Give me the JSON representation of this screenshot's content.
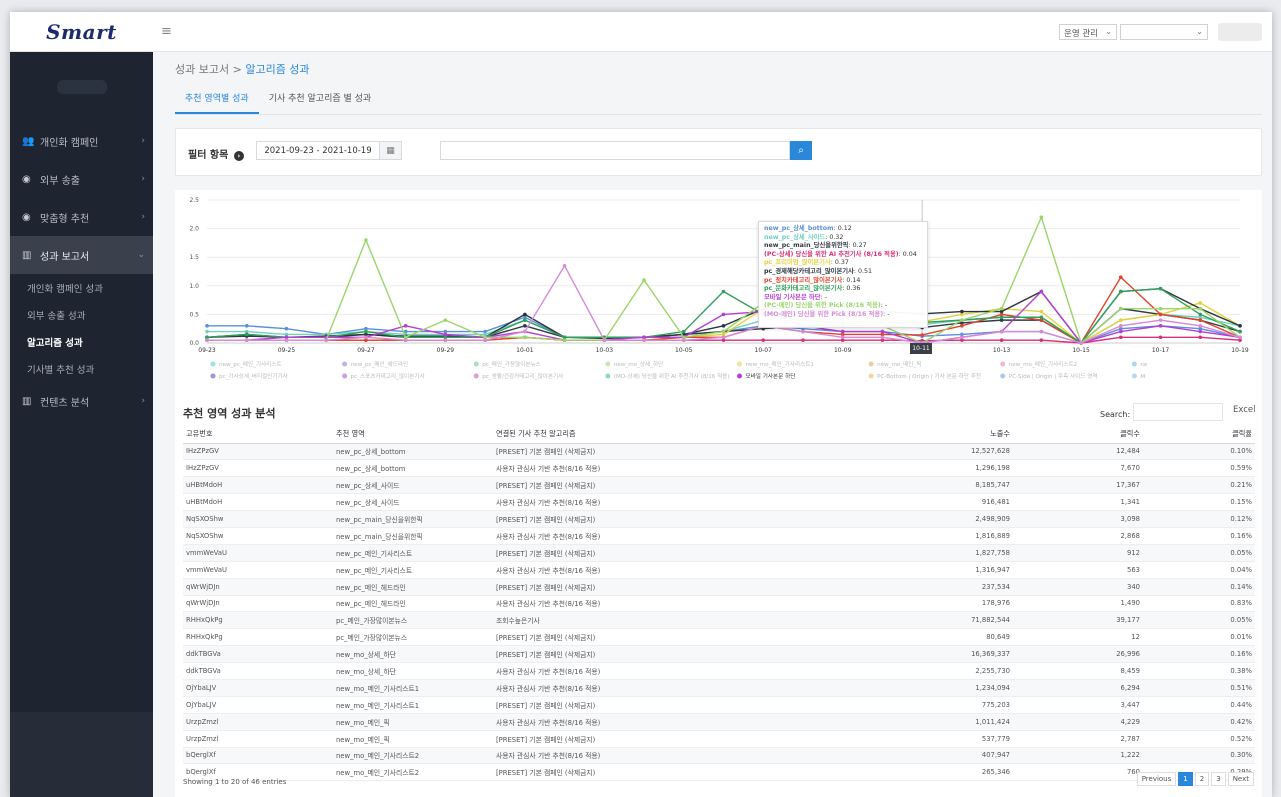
{
  "app": {
    "logo": "Smart"
  },
  "sidebar": {
    "items": [
      {
        "label": "개인화 캠페인",
        "icon": "users-icon"
      },
      {
        "label": "외부 송출",
        "icon": "target-icon"
      },
      {
        "label": "맞춤형 추천",
        "icon": "target-icon"
      },
      {
        "label": "성과 보고서",
        "icon": "bar-chart-icon"
      }
    ],
    "report_sub": [
      "개인화 캠페인 성과",
      "외부 송출 성과",
      "알고리즘 성과",
      "기사별 추천 성과"
    ],
    "bottom_item": {
      "label": "컨텐츠 분석",
      "icon": "bar-chart-icon"
    }
  },
  "topbar": {
    "menu_icon": "≡",
    "admin_select": "운영 관리",
    "site_select": ""
  },
  "breadcrumb": {
    "parent": "성과 보고서",
    "sep": ">",
    "current": "알고리즘 성과"
  },
  "tabs": [
    "추천 영역별 성과",
    "기사 추천 알고리즘 별 성과"
  ],
  "filter": {
    "label": "필터 항목",
    "date_range": "2021-09-23 - 2021-10-19",
    "search_value": ""
  },
  "chart_data": {
    "type": "line",
    "x": [
      "09-23",
      "09-24",
      "09-25",
      "09-26",
      "09-27",
      "09-28",
      "09-29",
      "09-30",
      "10-01",
      "10-02",
      "10-03",
      "10-04",
      "10-05",
      "10-06",
      "10-07",
      "10-08",
      "10-09",
      "10-10",
      "10-11",
      "10-12",
      "10-13",
      "10-14",
      "10-15",
      "10-16",
      "10-17",
      "10-18",
      "10-19"
    ],
    "x_ticks": [
      "09-23",
      "09-25",
      "09-27",
      "09-29",
      "10-01",
      "10-03",
      "10-05",
      "10-07",
      "10-09",
      "10-11",
      "10-13",
      "10-15",
      "10-17",
      "10-19"
    ],
    "y_ticks": [
      "0.0",
      "0.5",
      "1.0",
      "1.5",
      "2.0",
      "2.5"
    ],
    "ylim": [
      0,
      2.5
    ],
    "highlight_x": "10-11",
    "series": [
      {
        "name": "new_pc_상세_bottom",
        "color": "#5b8fd8",
        "values": [
          0.3,
          0.3,
          0.25,
          0.15,
          0.25,
          0.2,
          0.2,
          0.2,
          0.45,
          0.1,
          0.1,
          0.1,
          0.15,
          0.2,
          0.3,
          0.25,
          0.2,
          0.2,
          0.12,
          0.15,
          0.2,
          0.2,
          0.0,
          0.25,
          0.3,
          0.25,
          0.1
        ]
      },
      {
        "name": "new_pc_상세_사이드",
        "color": "#6fd0c0",
        "values": [
          0.2,
          0.2,
          0.15,
          0.15,
          0.2,
          0.15,
          0.15,
          0.15,
          0.4,
          0.1,
          0.1,
          0.1,
          0.1,
          0.2,
          0.4,
          0.4,
          0.35,
          0.35,
          0.32,
          0.4,
          0.45,
          0.45,
          0.0,
          0.4,
          0.5,
          0.45,
          0.3
        ]
      },
      {
        "name": "new_pc_main_당신을위한픽",
        "color": "#333a45",
        "values": [
          0.1,
          0.12,
          0.1,
          0.12,
          0.15,
          0.12,
          0.12,
          0.1,
          0.3,
          0.1,
          0.08,
          0.1,
          0.15,
          0.2,
          0.25,
          0.3,
          0.3,
          0.3,
          0.27,
          0.35,
          0.4,
          0.4,
          0.0,
          0.6,
          0.5,
          0.4,
          0.2
        ]
      },
      {
        "name": "(PC-상세) 당신을 위한 AI 추천기사 (8/16 적용)",
        "color": "#d62f7a",
        "values": [
          0.05,
          0.05,
          0.05,
          0.05,
          0.05,
          0.05,
          0.05,
          0.05,
          0.1,
          0.05,
          0.05,
          0.05,
          0.05,
          0.05,
          0.05,
          0.05,
          0.05,
          0.05,
          0.04,
          0.05,
          0.05,
          0.05,
          0.0,
          0.1,
          0.1,
          0.1,
          0.05
        ]
      },
      {
        "name": "pc_프리미엄_많이본기사",
        "color": "#e3d23a",
        "values": [
          0.05,
          0.05,
          0.05,
          0.05,
          0.1,
          0.05,
          0.05,
          0.05,
          0.1,
          0.05,
          0.05,
          0.05,
          0.1,
          0.15,
          0.6,
          0.5,
          0.4,
          0.4,
          0.37,
          0.5,
          0.6,
          0.55,
          0.0,
          0.4,
          0.5,
          0.7,
          0.3
        ]
      },
      {
        "name": "pc_경제해당카테고리_많이본기사",
        "color": "#2d3440",
        "values": [
          0.1,
          0.15,
          0.1,
          0.1,
          0.15,
          0.1,
          0.1,
          0.1,
          0.5,
          0.1,
          0.1,
          0.1,
          0.15,
          0.3,
          0.6,
          0.6,
          0.55,
          0.55,
          0.51,
          0.55,
          0.55,
          0.9,
          0.0,
          0.9,
          0.95,
          0.6,
          0.3
        ]
      },
      {
        "name": "pc_정치카테고리_많이본기사",
        "color": "#e0442f",
        "values": [
          0.05,
          0.05,
          0.05,
          0.05,
          0.05,
          0.05,
          0.05,
          0.05,
          0.1,
          0.05,
          0.05,
          0.05,
          0.1,
          0.1,
          0.3,
          0.2,
          0.15,
          0.15,
          0.14,
          0.3,
          0.5,
          0.4,
          0.0,
          1.15,
          0.5,
          0.4,
          0.1
        ]
      },
      {
        "name": "pc_문화카테고리_많이본기사",
        "color": "#2fa05a",
        "values": [
          0.1,
          0.15,
          0.1,
          0.1,
          0.2,
          0.1,
          0.1,
          0.1,
          0.4,
          0.1,
          0.1,
          0.1,
          0.2,
          0.9,
          0.5,
          0.4,
          0.35,
          0.35,
          0.36,
          0.4,
          0.45,
          0.45,
          0.0,
          0.9,
          0.95,
          0.5,
          0.2
        ]
      },
      {
        "name": "모바일 기사본문 하단",
        "color": "#b73dd3",
        "values": [
          0.05,
          0.05,
          0.1,
          0.1,
          0.1,
          0.3,
          0.15,
          0.1,
          0.2,
          0.05,
          0.05,
          0.1,
          0.1,
          0.5,
          0.55,
          0.3,
          0.2,
          0.2,
          0.0,
          0.1,
          0.2,
          0.9,
          0.0,
          0.2,
          0.3,
          0.2,
          0.1
        ]
      },
      {
        "name": "(PC-메인) 당신을 위한 Pick (8/16 적용)",
        "color": "#9bd46a",
        "values": [
          0.05,
          0.05,
          0.05,
          0.05,
          1.8,
          0.1,
          0.4,
          0.1,
          0.1,
          0.05,
          0.05,
          1.1,
          0.1,
          0.2,
          0.7,
          0.6,
          0.4,
          0.3,
          0.0,
          0.4,
          0.6,
          2.2,
          0.0,
          0.6,
          0.6,
          0.6,
          0.1
        ]
      },
      {
        "name": "(MO-메인) 당신을 위한 Pick (8/16 적용)",
        "color": "#d78ad9",
        "values": [
          0.05,
          0.05,
          0.05,
          0.05,
          0.1,
          0.05,
          0.05,
          0.05,
          0.2,
          1.35,
          0.05,
          0.05,
          0.05,
          0.1,
          0.3,
          0.2,
          0.1,
          0.1,
          0.0,
          0.1,
          0.2,
          0.2,
          0.0,
          0.3,
          0.4,
          0.3,
          0.1
        ]
      }
    ],
    "tooltip": [
      {
        "name": "new_pc_상세_bottom",
        "value": "0.12",
        "color": "#5b8fd8"
      },
      {
        "name": "new_pc_상세_사이드",
        "value": "0.32",
        "color": "#6fd0c0"
      },
      {
        "name": "new_pc_main_당신을위한픽",
        "value": "0.27",
        "color": "#333a45"
      },
      {
        "name": "(PC-상세) 당신을 위한 AI 추천기사 (8/16 적용)",
        "value": "0.04",
        "color": "#d62f7a"
      },
      {
        "name": "pc_프리미엄_많이본기사",
        "value": "0.37",
        "color": "#e3d23a"
      },
      {
        "name": "pc_경제해당카테고리_많이본기사",
        "value": "0.51",
        "color": "#2d3440"
      },
      {
        "name": "pc_정치카테고리_많이본기사",
        "value": "0.14",
        "color": "#e0442f"
      },
      {
        "name": "pc_문화카테고리_많이본기사",
        "value": "0.36",
        "color": "#2fa05a"
      },
      {
        "name": "모바일 기사본문 하단",
        "value": "-",
        "color": "#b73dd3"
      },
      {
        "name": "(PC-메인) 당신을 위한 Pick (8/16 적용)",
        "value": "-",
        "color": "#9bd46a"
      },
      {
        "name": "(MO-메인) 당신을 위한 Pick (8/16 적용)",
        "value": "-",
        "color": "#d78ad9"
      }
    ],
    "legend_row1": [
      {
        "name": "new_pc_메인_기사리스트",
        "color": "#9ee0e8"
      },
      {
        "name": "new_pc_메인_헤드라인",
        "color": "#b7b7e8"
      },
      {
        "name": "pc_메인_가장많이본뉴스",
        "color": "#a8e0c0"
      },
      {
        "name": "new_mo_상세_하단",
        "color": "#c8e8b0"
      },
      {
        "name": "new_mo_메인_기사리스트1",
        "color": "#f0e29a"
      },
      {
        "name": "new_mo_메인_픽",
        "color": "#f0c8a0"
      },
      {
        "name": "new_mo_메인_기사리스트2",
        "color": "#f0b8c8"
      },
      {
        "name": "ne",
        "color": "#a8d8f0"
      }
    ],
    "legend_row2": [
      {
        "name": "pc_기사상세_버티컬인기기사",
        "color": "#a890d8",
        "strong": false
      },
      {
        "name": "pc_스포츠카테고리_많이본기사",
        "color": "#c8a0e0",
        "strong": false
      },
      {
        "name": "pc_생활/건강카테고리_많이본기사",
        "color": "#d8a0d8",
        "strong": false
      },
      {
        "name": "(MO-상세) 당신을 위한 AI 추천기사 (8/16 적용)",
        "color": "#8fd8c8",
        "strong": false
      },
      {
        "name": "모바일 기사본문 하단",
        "color": "#b73dd3",
        "strong": true
      },
      {
        "name": "PC-Bottom | Origin | 기사 본문 하단 추천",
        "color": "#f0d89a",
        "strong": false
      },
      {
        "name": "PC-Side | Origin | 우측 사이드 영역",
        "color": "#a8c8f0",
        "strong": false
      },
      {
        "name": "M",
        "color": "#b8d8f0",
        "strong": false
      }
    ]
  },
  "table": {
    "title": "추천 영역 성과 분석",
    "search_label": "Search:",
    "excel_label": "Excel",
    "columns": [
      "고유번호",
      "추천 영역",
      "연결된 기사 추천 알고리즘",
      "노출수",
      "클릭수",
      "클릭율"
    ],
    "rows": [
      [
        "IHzZPzGV",
        "new_pc_상세_bottom",
        "[PRESET] 기본 캠페인 (삭제금지)",
        "12,527,628",
        "12,484",
        "0.10%"
      ],
      [
        "IHzZPzGV",
        "new_pc_상세_bottom",
        "사용자 관심사 기반 추천(8/16 적용)",
        "1,296,198",
        "7,670",
        "0.59%"
      ],
      [
        "uHBtMdoH",
        "new_pc_상세_사이드",
        "[PRESET] 기본 캠페인 (삭제금지)",
        "8,185,747",
        "17,367",
        "0.21%"
      ],
      [
        "uHBtMdoH",
        "new_pc_상세_사이드",
        "사용자 관심사 기반 추천(8/16 적용)",
        "916,481",
        "1,341",
        "0.15%"
      ],
      [
        "NqSXOShw",
        "new_pc_main_당신을위한픽",
        "[PRESET] 기본 캠페인 (삭제금지)",
        "2,498,909",
        "3,098",
        "0.12%"
      ],
      [
        "NqSXOShw",
        "new_pc_main_당신을위한픽",
        "사용자 관심사 기반 추천(8/16 적용)",
        "1,816,889",
        "2,868",
        "0.16%"
      ],
      [
        "vmmWeVaU",
        "new_pc_메인_기사리스트",
        "[PRESET] 기본 캠페인 (삭제금지)",
        "1,827,758",
        "912",
        "0.05%"
      ],
      [
        "vmmWeVaU",
        "new_pc_메인_기사리스트",
        "사용자 관심사 기반 추천(8/16 적용)",
        "1,316,947",
        "563",
        "0.04%"
      ],
      [
        "qWrWjDJn",
        "new_pc_메인_헤드라인",
        "[PRESET] 기본 캠페인 (삭제금지)",
        "237,534",
        "340",
        "0.14%"
      ],
      [
        "qWrWjDJn",
        "new_pc_메인_헤드라인",
        "사용자 관심사 기반 추천(8/16 적용)",
        "178,976",
        "1,490",
        "0.83%"
      ],
      [
        "RHHxQkPg",
        "pc_메인_가장많이본뉴스",
        "조회수높은기사",
        "71,882,544",
        "39,177",
        "0.05%"
      ],
      [
        "RHHxQkPg",
        "pc_메인_가장많이본뉴스",
        "[PRESET] 기본 캠페인 (삭제금지)",
        "80,649",
        "12",
        "0.01%"
      ],
      [
        "ddkTBGVa",
        "new_mo_상세_하단",
        "[PRESET] 기본 캠페인 (삭제금지)",
        "16,369,337",
        "26,996",
        "0.16%"
      ],
      [
        "ddkTBGVa",
        "new_mo_상세_하단",
        "사용자 관심사 기반 추천(8/16 적용)",
        "2,255,730",
        "8,459",
        "0.38%"
      ],
      [
        "OjYbaLJV",
        "new_mo_메인_기사리스트1",
        "사용자 관심사 기반 추천(8/16 적용)",
        "1,234,094",
        "6,294",
        "0.51%"
      ],
      [
        "OjYbaLJV",
        "new_mo_메인_기사리스트1",
        "[PRESET] 기본 캠페인 (삭제금지)",
        "775,203",
        "3,447",
        "0.44%"
      ],
      [
        "UrzpZmzl",
        "new_mo_메인_픽",
        "사용자 관심사 기반 추천(8/16 적용)",
        "1,011,424",
        "4,229",
        "0.42%"
      ],
      [
        "UrzpZmzl",
        "new_mo_메인_픽",
        "[PRESET] 기본 캠페인 (삭제금지)",
        "537,779",
        "2,787",
        "0.52%"
      ],
      [
        "bQerglXf",
        "new_mo_메인_기사리스트2",
        "사용자 관심사 기반 추천(8/16 적용)",
        "407,947",
        "1,222",
        "0.30%"
      ],
      [
        "bQerglXf",
        "new_mo_메인_기사리스트2",
        "[PRESET] 기본 캠페인 (삭제금지)",
        "265,346",
        "760",
        "0.29%"
      ]
    ],
    "info": "Showing 1 to 20 of 46 entries",
    "pagination": [
      "Previous",
      "1",
      "2",
      "3",
      "Next"
    ]
  }
}
